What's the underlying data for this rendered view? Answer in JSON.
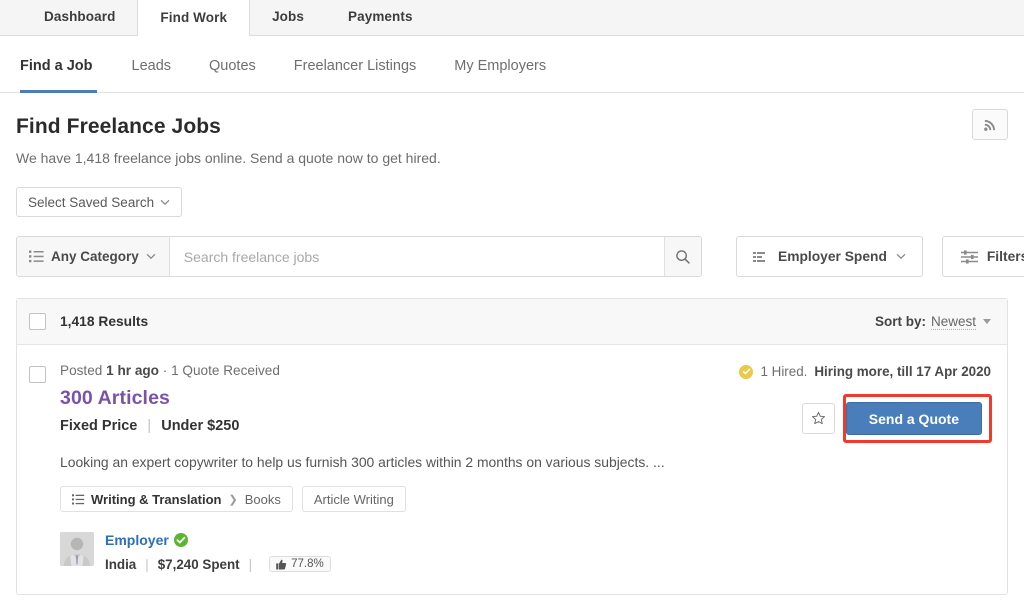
{
  "topnav": {
    "tabs": [
      {
        "label": "Dashboard",
        "active": false
      },
      {
        "label": "Find Work",
        "active": true
      },
      {
        "label": "Jobs",
        "active": false
      },
      {
        "label": "Payments",
        "active": false
      }
    ]
  },
  "subnav": {
    "items": [
      {
        "label": "Find a Job",
        "active": true
      },
      {
        "label": "Leads",
        "active": false
      },
      {
        "label": "Quotes",
        "active": false
      },
      {
        "label": "Freelancer Listings",
        "active": false
      },
      {
        "label": "My Employers",
        "active": false
      }
    ]
  },
  "header": {
    "title": "Find Freelance Jobs",
    "subtitle": "We have 1,418 freelance jobs online. Send a quote now to get hired.",
    "rss_icon": "rss-icon"
  },
  "saved_search": {
    "label": "Select Saved Search",
    "chevron_icon": "chevron-down-icon"
  },
  "search": {
    "category_label": "Any Category",
    "category_icon": "list-icon",
    "placeholder": "Search freelance jobs",
    "value": "",
    "search_icon": "search-icon",
    "employer_spend_label": "Employer Spend",
    "employer_spend_icon": "bar-chart-icon",
    "filters_label": "Filters",
    "filters_icon": "sliders-icon"
  },
  "results": {
    "count_label": "1,418 Results",
    "sort_label": "Sort by:",
    "sort_value": "Newest"
  },
  "job": {
    "posted_prefix": "Posted",
    "posted_time": "1 hr ago",
    "meta_sep": "·",
    "quotes": "1 Quote Received",
    "title": "300 Articles",
    "price_type": "Fixed Price",
    "price_value": "Under $250",
    "description": "Looking an expert copywriter to help us furnish 300 articles within 2 months on various subjects. ...",
    "tags": [
      {
        "category": "Writing & Translation",
        "sub": "Books",
        "icon": "list-icon",
        "has_chevron": true
      },
      {
        "category": "",
        "sub": "Article Writing",
        "icon": "",
        "has_chevron": false
      }
    ],
    "hired_count": "1 Hired.",
    "hiring_more": "Hiring more, till 17 Apr 2020",
    "hired_icon": "check-circle-icon",
    "favorite_icon": "star-icon",
    "cta_label": "Send a Quote",
    "employer": {
      "name": "Employer",
      "verified_icon": "verified-check-icon",
      "country": "India",
      "spent": "$7,240 Spent",
      "rating": "77.8%",
      "rating_icon": "thumbs-up-icon",
      "avatar_icon": "user-avatar-icon"
    }
  },
  "colors": {
    "accent_blue": "#4a7ebb",
    "title_purple": "#7b52ab",
    "highlight_red": "#ef3b2d",
    "verified_green": "#5cb531",
    "hired_gold": "#ebc846"
  }
}
